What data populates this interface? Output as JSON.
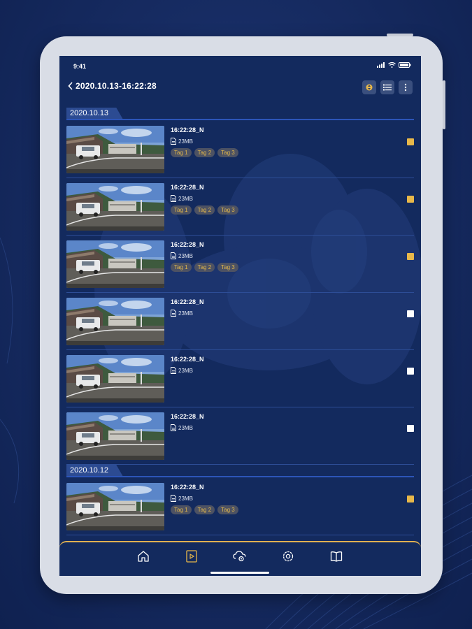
{
  "status_bar": {
    "time": "9:41"
  },
  "header": {
    "title": "2020.10.13-16:22:28"
  },
  "groups": [
    {
      "date": "2020.10.13",
      "items": [
        {
          "name": "16:22:28_N",
          "size": "23MB",
          "tags": [
            "Tag 1",
            "Tag 2",
            "Tag 3"
          ],
          "checked": true
        },
        {
          "name": "16:22:28_N",
          "size": "23MB",
          "tags": [
            "Tag 1",
            "Tag 2",
            "Tag 3"
          ],
          "checked": true
        },
        {
          "name": "16:22:28_N",
          "size": "23MB",
          "tags": [
            "Tag 1",
            "Tag 2",
            "Tag 3"
          ],
          "checked": true
        },
        {
          "name": "16:22:28_N",
          "size": "23MB",
          "tags": [],
          "checked": false
        },
        {
          "name": "16:22:28_N",
          "size": "23MB",
          "tags": [],
          "checked": false
        },
        {
          "name": "16:22:28_N",
          "size": "23MB",
          "tags": [],
          "checked": false
        }
      ]
    },
    {
      "date": "2020.10.12",
      "items": [
        {
          "name": "16:22:28_N",
          "size": "23MB",
          "tags": [
            "Tag 1",
            "Tag 2",
            "Tag 3"
          ],
          "checked": true
        }
      ]
    }
  ],
  "tab_icons": [
    "home-icon",
    "video-file-icon",
    "cloud-settings-icon",
    "settings-gear-icon",
    "manual-book-icon"
  ],
  "colors": {
    "accent": "#e8b84a",
    "background": "#132a5e",
    "divider": "#2d4d96"
  }
}
